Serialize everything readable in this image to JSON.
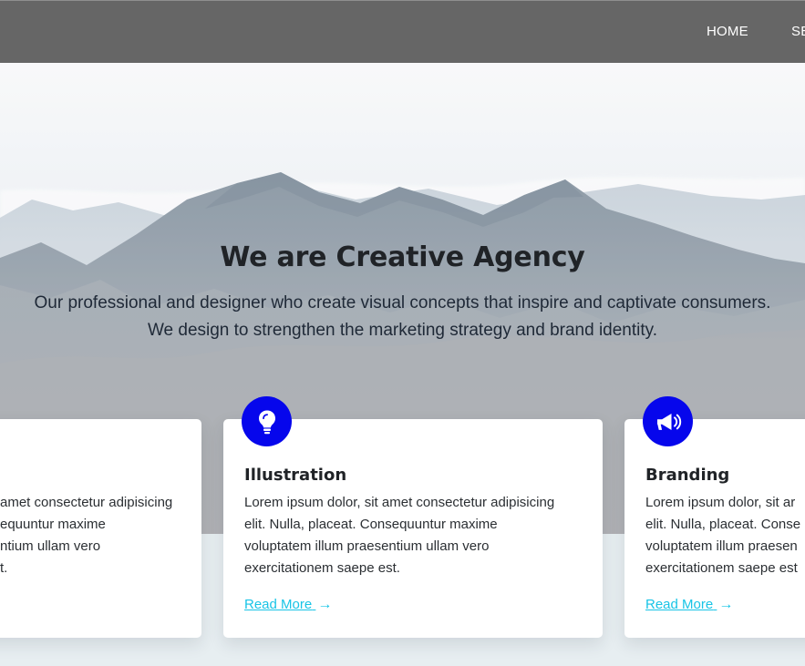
{
  "nav": {
    "items": [
      "HOME",
      "SE"
    ]
  },
  "hero": {
    "title": "We are Creative Agency",
    "line1": "Our professional and designer who create visual concepts that inspire and captivate consumers.",
    "line2": "We design to strengthen the marketing strategy and brand identity."
  },
  "cards": {
    "left": {
      "line1": "amet consectetur adipisicing",
      "line2": "equuntur maxime",
      "line3": "ntium ullam vero",
      "line4": "t."
    },
    "middle": {
      "title": "Illustration",
      "line1": "Lorem ipsum dolor, sit amet consectetur adipisicing",
      "line2": "elit. Nulla, placeat. Consequuntur maxime",
      "line3": "voluptatem illum praesentium ullam vero",
      "line4": "exercitationem saepe est.",
      "link": "Read More"
    },
    "right": {
      "title": "Branding",
      "line1": "Lorem ipsum dolor, sit ar",
      "line2": "elit. Nulla, placeat. Conse",
      "line3": "voluptatem illum praesen",
      "line4": "exercitationem saepe est",
      "link": "Read More"
    }
  },
  "colors": {
    "nav_bg": "#666666",
    "accent": "#0606ec",
    "link": "#18c4e6"
  },
  "icons": {
    "middle": "lightbulb-icon",
    "right": "megaphone-icon",
    "arrow": "arrow-right-icon"
  }
}
